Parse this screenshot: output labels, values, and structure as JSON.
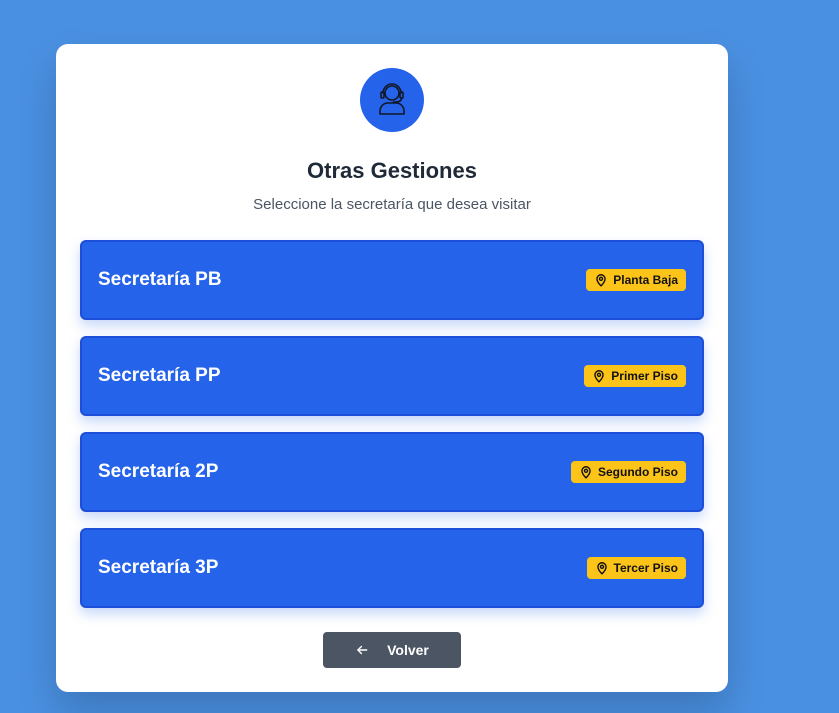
{
  "header": {
    "icon": "support-agent-icon",
    "title": "Otras Gestiones",
    "subtitle": "Seleccione la secretaría que desea visitar"
  },
  "options": [
    {
      "label": "Secretaría PB",
      "location": "Planta Baja",
      "icon": "map-pin-icon"
    },
    {
      "label": "Secretaría PP",
      "location": "Primer Piso",
      "icon": "map-pin-icon"
    },
    {
      "label": "Secretaría 2P",
      "location": "Segundo Piso",
      "icon": "map-pin-icon"
    },
    {
      "label": "Secretaría 3P",
      "location": "Tercer Piso",
      "icon": "map-pin-icon"
    }
  ],
  "footer": {
    "back_label": "Volver",
    "back_icon": "arrow-left-icon"
  },
  "colors": {
    "background": "#4a90e2",
    "primary": "#2563eb",
    "badge": "#fcc419",
    "back_button": "#4b5563"
  }
}
